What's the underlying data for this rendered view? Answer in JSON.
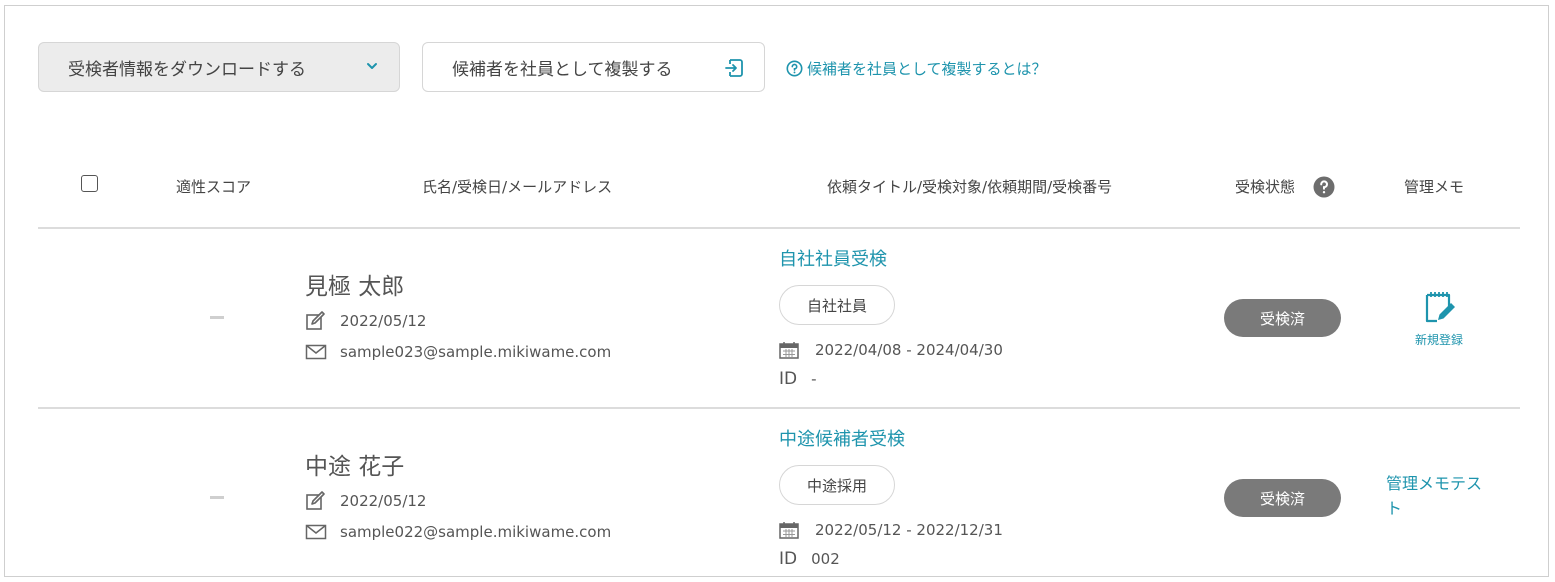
{
  "toolbar": {
    "download_label": "受検者情報をダウンロードする",
    "duplicate_label": "候補者を社員として複製する",
    "help_link": "候補者を社員として複製するとは？"
  },
  "table": {
    "headers": {
      "score": "適性スコア",
      "person": "氏名/受検日/メールアドレス",
      "request": "依頼タイトル/受検対象/依頼期間/受検番号",
      "status": "受検状態",
      "memo": "管理メモ"
    },
    "rows": [
      {
        "score": "–",
        "name": "見極 太郎",
        "exam_date": "2022/05/12",
        "email": "sample023@sample.mikiwame.com",
        "request_title": "自社社員受検",
        "target": "自社社員",
        "period": "2022/04/08 - 2024/04/30",
        "id_label": "ID",
        "id_value": "-",
        "status": "受検済",
        "memo": "新規登録"
      },
      {
        "score": "–",
        "name": "中途 花子",
        "exam_date": "2022/05/12",
        "email": "sample022@sample.mikiwame.com",
        "request_title": "中途候補者受検",
        "target": "中途採用",
        "period": "2022/05/12 - 2022/12/31",
        "id_label": "ID",
        "id_value": "002",
        "status": "受検済",
        "memo": "管理メモテスト"
      }
    ]
  },
  "colors": {
    "accent": "#1e94ad",
    "status_pill": "#7a7a7a",
    "border": "#d6d6d6"
  },
  "icons": [
    "chevron-down-icon",
    "duplicate-icon",
    "question-circle-icon",
    "edit-icon",
    "mail-icon",
    "calendar-icon",
    "memo-new-icon"
  ]
}
